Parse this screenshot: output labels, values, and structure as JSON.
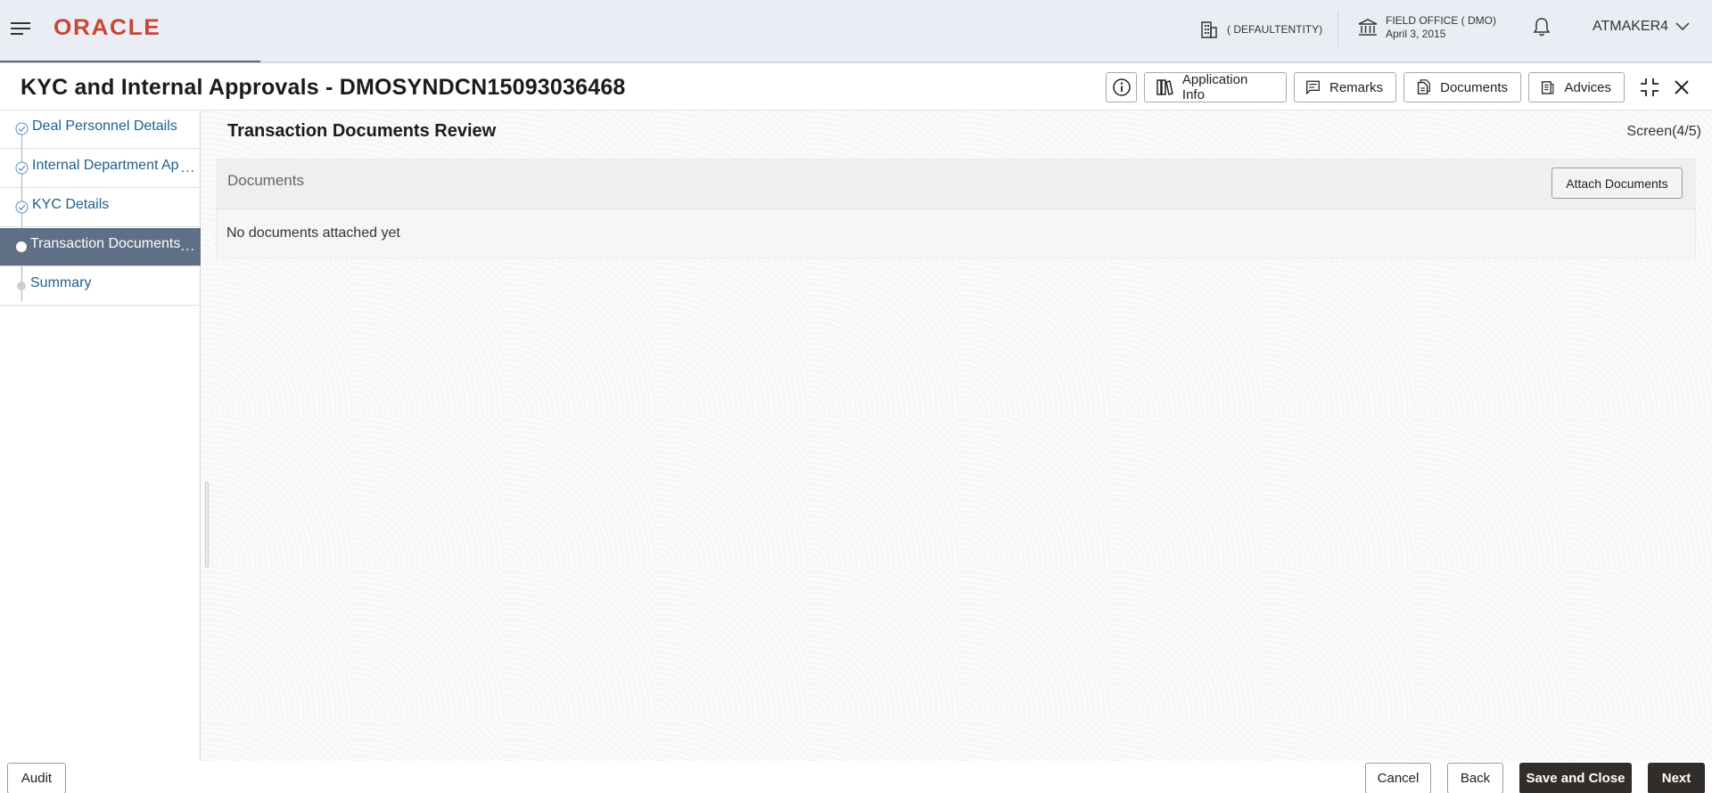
{
  "header": {
    "brand": "ORACLE",
    "entity": "( DEFAULTENTITY)",
    "office_name": "FIELD OFFICE ( DMO)",
    "office_date": "April 3, 2015",
    "user": "ATMAKER4"
  },
  "window": {
    "title": "KYC and Internal Approvals - DMOSYNDCN15093036468",
    "toolbar": {
      "application_info": "Application Info",
      "remarks": "Remarks",
      "documents": "Documents",
      "advices": "Advices"
    }
  },
  "train": {
    "steps": [
      {
        "label": "Deal Personnel Details",
        "state": "completed"
      },
      {
        "label": "Internal Department Ap",
        "state": "completed"
      },
      {
        "label": "KYC Details",
        "state": "completed"
      },
      {
        "label": "Transaction Documents",
        "state": "active"
      },
      {
        "label": "Summary",
        "state": "pending"
      }
    ],
    "ellipsis": "..."
  },
  "main": {
    "section_title": "Transaction Documents Review",
    "screen_counter": "Screen(4/5)",
    "documents": {
      "title": "Documents",
      "attach_label": "Attach Documents",
      "empty_message": "No documents attached yet"
    }
  },
  "footer": {
    "audit": "Audit",
    "cancel": "Cancel",
    "back": "Back",
    "save_close": "Save and Close",
    "next": "Next"
  },
  "colors": {
    "brand": "#c74634",
    "active_step_bg": "#5f6f86",
    "link": "#1f5f8b",
    "primary_button": "#312d2a"
  }
}
